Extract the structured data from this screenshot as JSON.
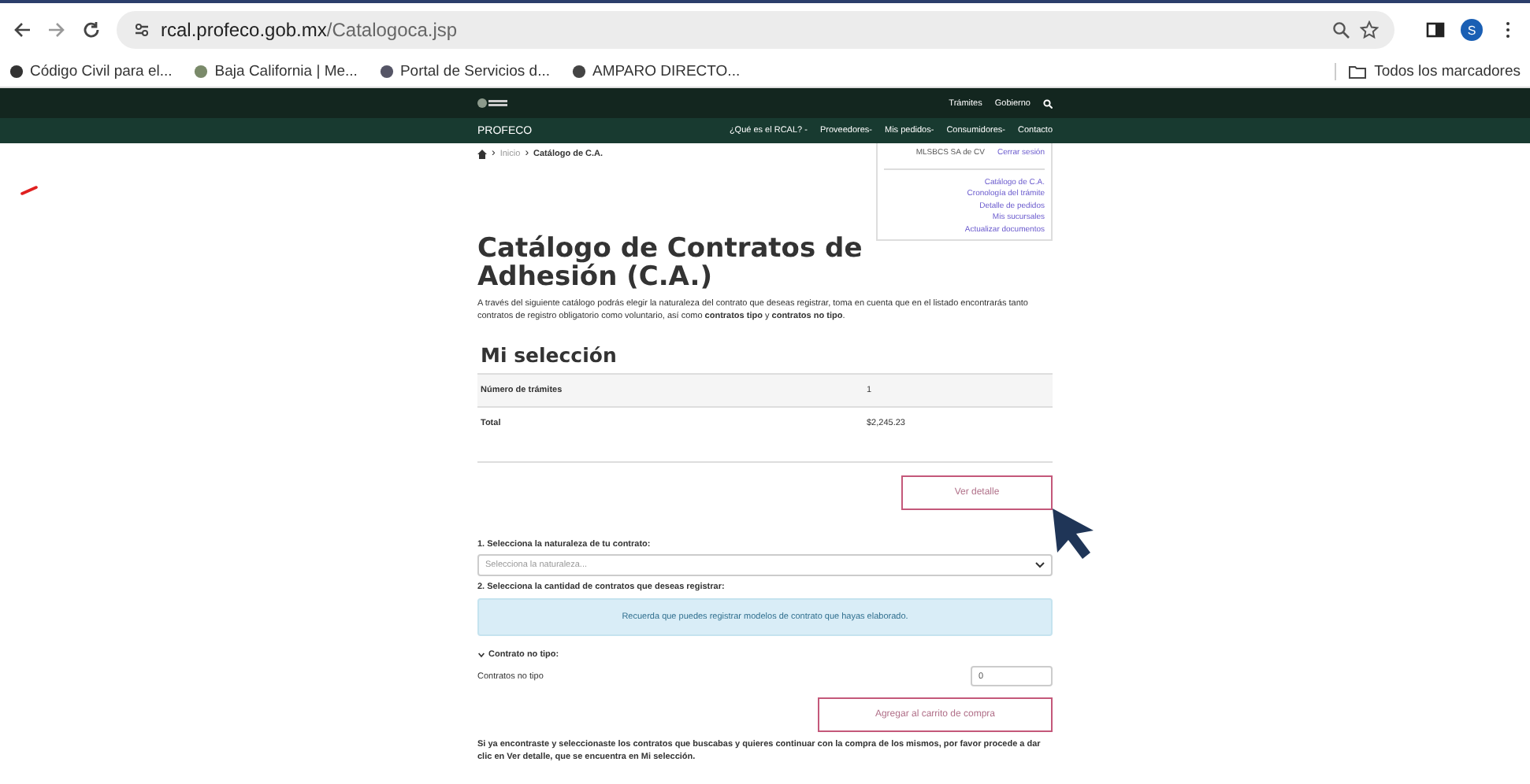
{
  "browser": {
    "url_host": "rcal.profeco.gob.mx",
    "url_path": "/Catalogoca.jsp",
    "profile_initial": "S",
    "bookmarks": [
      "Código Civil para el...",
      "Baja California | Me...",
      "Portal de Servicios d...",
      "AMPARO DIRECTO..."
    ],
    "bookmarks_folder": "Todos los marcadores"
  },
  "header": {
    "top_links": [
      "Trámites",
      "Gobierno"
    ],
    "brand": "PROFECO",
    "nav": [
      "¿Qué es el RCAL? -",
      "Proveedores-",
      "Mis pedidos-",
      "Consumidores-",
      "Contacto"
    ]
  },
  "breadcrumb": [
    "Inicio",
    "Catálogo de C.A."
  ],
  "breadcrumb_separator": "›",
  "user_menu": {
    "user": "MLSBCS SA de CV",
    "logout": "Cerrar sesión",
    "links": [
      "Catálogo de C.A.",
      "Cronología del trámite",
      "Detalle de pedidos",
      "Mis sucursales",
      "Actualizar documentos"
    ]
  },
  "title": "Catálogo de Contratos de Adhesión (C.A.)",
  "intro": "A través del siguiente catálogo podrás elegir la naturaleza del contrato que deseas registrar, toma en cuenta que en el listado encontrarás tanto contratos de registro obligatorio como voluntario, así como **contratos tipo** y **contratos no tipo**.",
  "selection": {
    "title": "Mi selección",
    "rows": [
      {
        "label": "Número de trámites",
        "value": "1"
      },
      {
        "label": "Total",
        "value": "$2,245.23"
      }
    ],
    "button": "Ver detalle"
  },
  "step1": {
    "label": "1. Selecciona la naturaleza de tu contrato:",
    "placeholder": "Selecciona la naturaleza..."
  },
  "step2": {
    "label": "2. Selecciona la cantidad de contratos que deseas registrar:",
    "alert": "Recuerda que puedes registrar modelos de contrato que hayas elaborado."
  },
  "section": {
    "title": "Contrato no tipo:",
    "expanded": true,
    "field_label": "Contratos no tipo",
    "field_value": "0",
    "button": "Agregar al carrito de compra"
  },
  "note": "Si ya encontraste y seleccionaste los contratos que buscabas y quieres continuar con la compra de los mismos, por favor procede a dar clic en Ver detalle, que se encuentra en Mi selección."
}
